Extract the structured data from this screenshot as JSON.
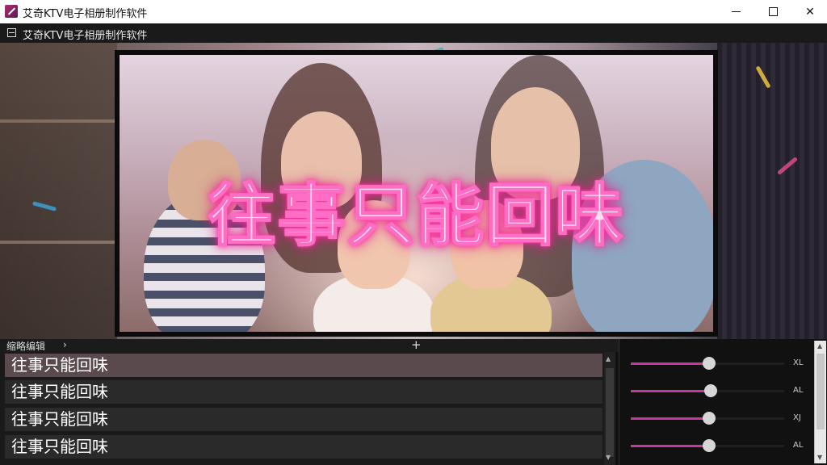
{
  "window": {
    "title": "艾奇KTV电子相册制作软件"
  },
  "menubar": {
    "title": "艾奇KTV电子相册制作软件"
  },
  "preview": {
    "headline": "往事只能回味"
  },
  "timeline": {
    "label": "缩略编辑",
    "chevron": "›",
    "add": "+"
  },
  "list": {
    "rows": [
      {
        "text": "往事只能回味",
        "selected": true
      },
      {
        "text": "往事只能回味",
        "selected": false
      },
      {
        "text": "往事只能回味",
        "selected": false
      },
      {
        "text": "往事只能回味",
        "selected": false
      }
    ]
  },
  "panel": {
    "sliders": [
      {
        "label": "XL",
        "value": 0.51
      },
      {
        "label": "AL",
        "value": 0.52
      },
      {
        "label": "XJ",
        "value": 0.51
      },
      {
        "label": "AL",
        "value": 0.51
      }
    ]
  },
  "colors": {
    "accent": "#c23a9e",
    "neon": "#ff2a9a"
  }
}
